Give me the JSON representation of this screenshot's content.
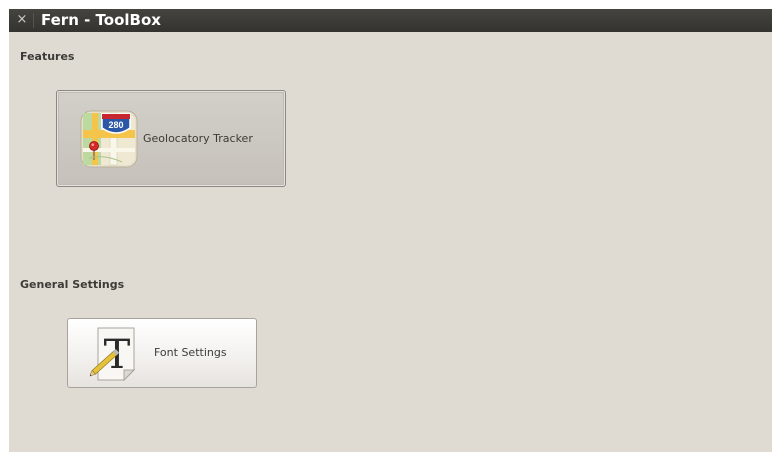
{
  "window": {
    "title": "Fern - ToolBox",
    "close_glyph": "×"
  },
  "sections": {
    "features": {
      "label": "Features",
      "items": [
        {
          "label": "Geolocatory Tracker",
          "icon": "map-icon",
          "state": "pressed"
        }
      ]
    },
    "general_settings": {
      "label": "General Settings",
      "items": [
        {
          "label": "Font Settings",
          "icon": "font-icon",
          "state": "normal"
        }
      ]
    }
  },
  "icon_text": {
    "map_sign": "280",
    "font_letter": "T"
  },
  "colors": {
    "titlebar": "#3c3b37",
    "window_bg": "#dfdbd2",
    "text": "#3c3b37"
  }
}
